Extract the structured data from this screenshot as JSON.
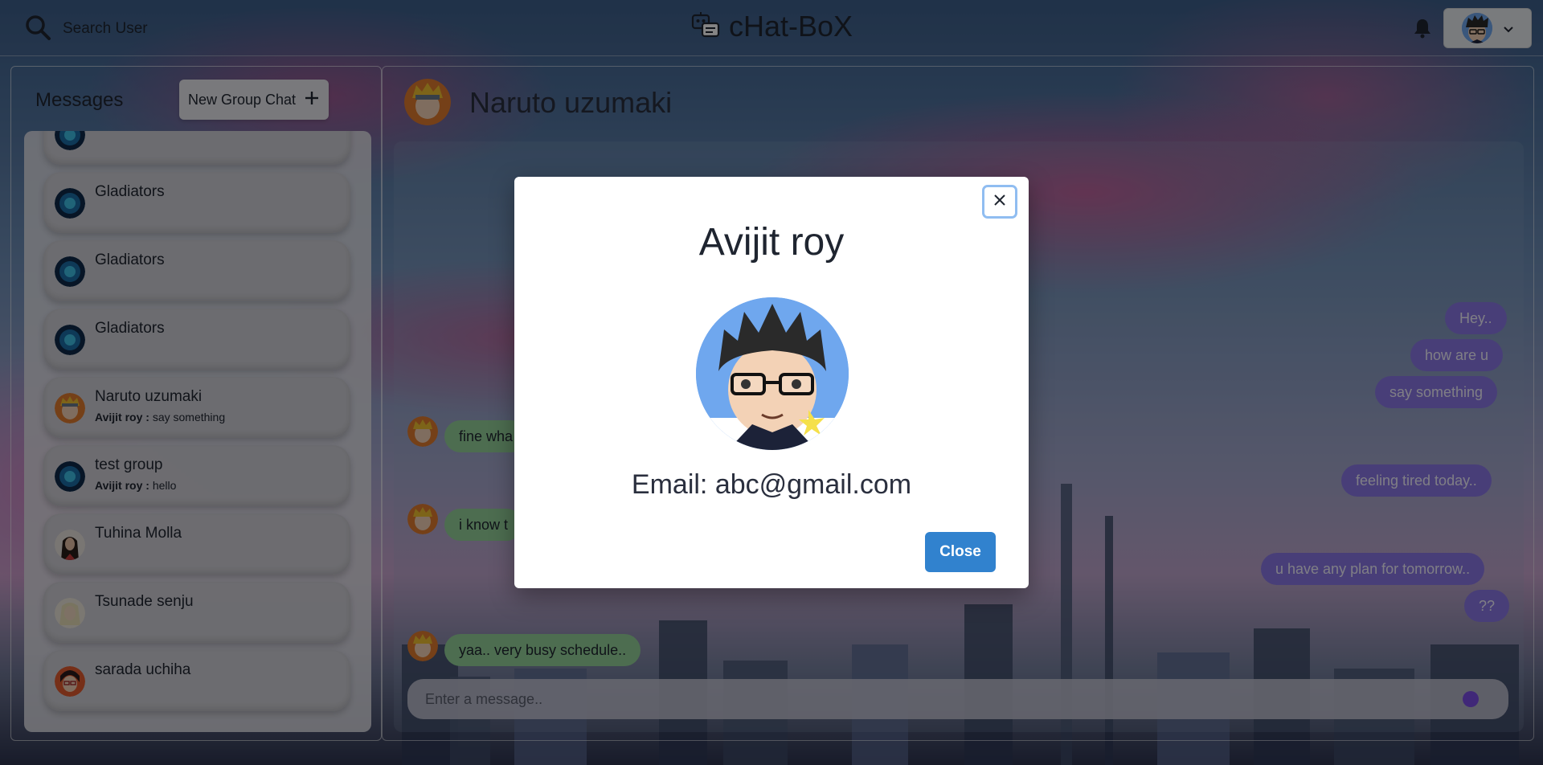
{
  "header": {
    "search_label": "Search User",
    "app_title": "cHat-BoX"
  },
  "sidebar": {
    "title": "Messages",
    "new_group_label": "New Group Chat",
    "chats": [
      {
        "name": "",
        "sender": "",
        "preview": ""
      },
      {
        "name": "Gladiators",
        "sender": "",
        "preview": ""
      },
      {
        "name": "Gladiators",
        "sender": "",
        "preview": ""
      },
      {
        "name": "Gladiators",
        "sender": "",
        "preview": ""
      },
      {
        "name": "Naruto uzumaki",
        "sender": "Avijit roy",
        "preview": "say something"
      },
      {
        "name": "test group",
        "sender": "Avijit roy",
        "preview": "hello"
      },
      {
        "name": "Tuhina Molla",
        "sender": "",
        "preview": ""
      },
      {
        "name": "Tsunade senju",
        "sender": "",
        "preview": ""
      },
      {
        "name": "sarada uchiha",
        "sender": "",
        "preview": ""
      }
    ],
    "sender_separator": " : "
  },
  "chat": {
    "contact_name": "Naruto uzumaki",
    "messages": [
      {
        "from": "me",
        "text": "Hey.."
      },
      {
        "from": "me",
        "text": "how are u"
      },
      {
        "from": "me",
        "text": "say something"
      },
      {
        "from": "them",
        "text": "fine wha"
      },
      {
        "from": "me",
        "text": "feeling tired today.."
      },
      {
        "from": "them",
        "text": "i know t"
      },
      {
        "from": "me",
        "text": "u have any plan for tomorrow.."
      },
      {
        "from": "me",
        "text": "??"
      },
      {
        "from": "them",
        "text": "yaa.. very busy schedule.."
      }
    ],
    "input_placeholder": "Enter a message.."
  },
  "modal": {
    "title": "Avijit roy",
    "email_text": "Email: abc@gmail.com",
    "close_label": "Close"
  },
  "colors": {
    "primary_button": "#3182ce",
    "my_bubble": "#8b78e6",
    "their_bubble": "#94d199",
    "close_focus_ring": "#90bdf1"
  },
  "icons": {
    "search": "search-icon",
    "logo": "robot-chat-icon",
    "bell": "bell-icon",
    "chevron": "chevron-down-icon",
    "plus": "plus-icon",
    "close": "close-icon",
    "emoji": "emoji-icon"
  }
}
